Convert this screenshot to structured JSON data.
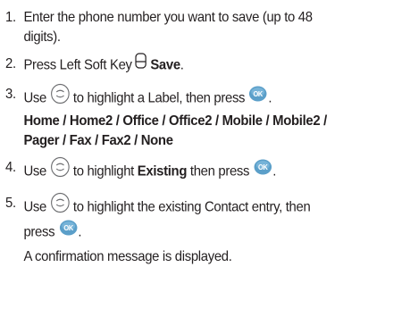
{
  "steps": [
    {
      "number": "1.",
      "text": "Enter the phone number you want to save (up to 48",
      "text_cont": "digits)."
    },
    {
      "number": "2.",
      "pre": "Press Left Soft Key",
      "bold": "Save",
      "post": ".",
      "icon": "left-soft-key-icon"
    },
    {
      "number": "3.",
      "pre": "Use",
      "mid": "to highlight a Label, then press",
      "post": ".",
      "icons": [
        "navigation-key-icon",
        "ok-key-icon"
      ],
      "labels_line1": "Home / Home2 / Office / Office2 / Mobile / Mobile2 /",
      "labels_line2": "Pager / Fax / Fax2 / None"
    },
    {
      "number": "4.",
      "pre": "Use",
      "mid": "to highlight",
      "bold": "Existing",
      "mid2": "then press",
      "post": ".",
      "icons": [
        "navigation-key-icon",
        "ok-key-icon"
      ]
    },
    {
      "number": "5.",
      "pre": "Use",
      "mid": "to highlight the existing Contact entry, then",
      "line2_pre": "press",
      "post": ".",
      "note": "A confirmation message is displayed.",
      "icons": [
        "navigation-key-icon",
        "ok-key-icon"
      ]
    }
  ],
  "colors": {
    "text": "#231f20",
    "ok_key": "#5b9fc9"
  }
}
